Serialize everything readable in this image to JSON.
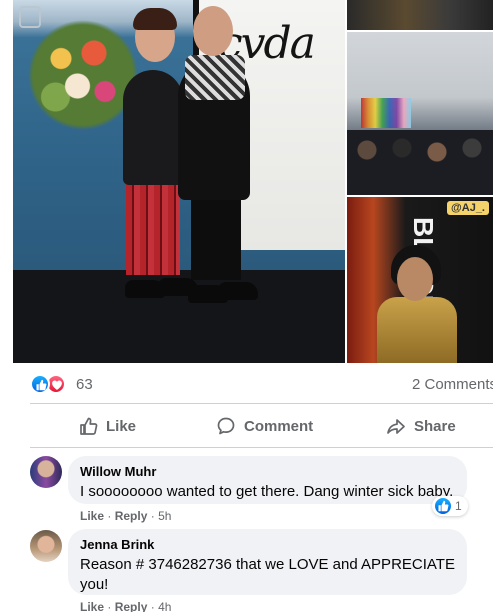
{
  "photos": {
    "main_banner_text": "cvda",
    "bottom_right_sign": "BLACK MATTE",
    "bottom_right_watermark": "@AJ_."
  },
  "reactions": {
    "count": "63",
    "comments_label": "2 Comments",
    "icons": [
      "like-icon",
      "love-icon"
    ],
    "like_color": "#1877f2",
    "love_color": "#f33e58"
  },
  "actions": {
    "like": "Like",
    "comment": "Comment",
    "share": "Share"
  },
  "comments": [
    {
      "author": "Willow Muhr",
      "text": "I soooooooo wanted to get there. Dang winter sick baby.",
      "like_label": "Like",
      "reply_label": "Reply",
      "time": "5h",
      "reaction_count": "1"
    },
    {
      "author": "Jenna Brink",
      "text": "Reason # 3746282736 that we LOVE and APPRECIATE you!",
      "like_label": "Like",
      "reply_label": "Reply",
      "time": "4h"
    }
  ],
  "colors": {
    "secondary_text": "#65676b",
    "bubble_bg": "#f0f2f5",
    "divider": "#ced0d4"
  }
}
